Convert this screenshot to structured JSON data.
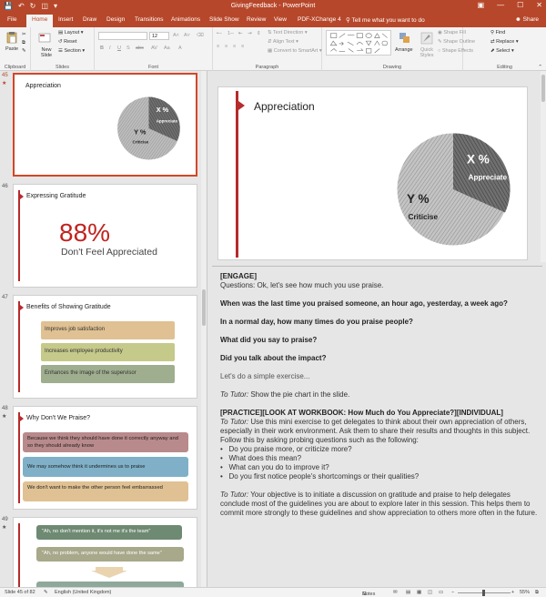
{
  "window": {
    "title": "GivingFeedback - PowerPoint",
    "minimize_glyph": "—",
    "maximize_glyph": "☐",
    "close_glyph": "✕"
  },
  "tabs": [
    "File",
    "Home",
    "Insert",
    "Draw",
    "Design",
    "Transitions",
    "Animations",
    "Slide Show",
    "Review",
    "View",
    "PDF-XChange 4"
  ],
  "tell_me": "Tell me what you want to do",
  "share": "Share",
  "ribbon": {
    "clipboard": {
      "paste": "Paste",
      "label": "Clipboard"
    },
    "slides": {
      "new_slide": "New Slide",
      "layout": "Layout",
      "reset": "Reset",
      "section": "Section",
      "label": "Slides"
    },
    "font": {
      "size": "12",
      "label": "Font"
    },
    "paragraph": {
      "text_direction": "Text Direction",
      "align_text": "Align Text",
      "convert": "Convert to SmartArt",
      "label": "Paragraph"
    },
    "drawing": {
      "arrange": "Arrange",
      "quick_styles": "Quick Styles",
      "shape_fill": "Shape Fill",
      "shape_outline": "Shape Outline",
      "shape_effects": "Shape Effects",
      "label": "Drawing"
    },
    "editing": {
      "find": "Find",
      "replace": "Replace",
      "select": "Select",
      "label": "Editing"
    }
  },
  "thumbnails": {
    "s45": {
      "num": "45",
      "title": "Appreciation",
      "x_label": "X %",
      "x_sub": "Appreciate",
      "y_label": "Y %",
      "y_sub": "Criticise"
    },
    "s46": {
      "num": "46",
      "title": "Expressing Gratitude",
      "big": "88%",
      "sub": "Don't Feel Appreciated"
    },
    "s47": {
      "num": "47",
      "title": "Benefits of Showing Gratitude",
      "items": [
        "Improves job satisfaction",
        "Increases employee productivity",
        "Enhances the image of the supervisor"
      ]
    },
    "s48": {
      "num": "48",
      "title": "Why Don't We Praise?",
      "items": [
        "Because we think they should have done it correctly anyway and so they should already know",
        "We may somehow think it undermines us to praise",
        "We don't want to make the other person feel embarrassed"
      ]
    },
    "s49": {
      "num": "49",
      "items": [
        "\"Ah, no don't mention it, it's not me it's the team\"",
        "\"Ah, no problem, anyone would have done the same\""
      ]
    }
  },
  "slide": {
    "title": "Appreciation",
    "x_label": "X %",
    "x_sub": "Appreciate",
    "y_label": "Y %",
    "y_sub": "Criticise"
  },
  "notes": {
    "engage": "[ENGAGE]",
    "questions": "Questions:  Ok, let's see how much you use praise.",
    "q1": "When was the last time you praised someone, an hour ago, yesterday, a week ago?",
    "q2": "In a normal day, how many times do you praise people?",
    "q3": "What did you say to praise?",
    "q4": "Did you talk about the impact?",
    "exercise": "Let's do a simple exercise...",
    "tutor1_label": "To Tutor:",
    "tutor1_text": " Show the pie chart in the slide.",
    "practice": "[PRACTICE][LOOK AT WORKBOOK: How Much do You Appreciate?][INDIVIDUAL]",
    "tutor2_label": "To Tutor:",
    "tutor2_text": " Use this mini exercise to get delegates to think about their own appreciation of others, especially in their work environment. Ask them to share their results and thoughts in this subject. Follow this by asking probing questions such as the following:",
    "bullets": [
      "Do you praise more, or criticize more?",
      "What does this mean?",
      "What can you do to improve it?",
      "Do you first notice people's shortcomings or their qualities?"
    ],
    "tutor3_label": "To Tutor:",
    "tutor3_text": " Your objective is to initiate a discussion on gratitude and praise to help delegates conclude most of the guidelines you are about to explore later in this session. This helps them to commit more strongly to these guidelines and show appreciation to others more often in the future."
  },
  "status": {
    "slide": "Slide 45 of 82",
    "language": "English (United Kingdom)",
    "notes": "Notes",
    "zoom": "55%"
  },
  "colors": {
    "accent": "#b7472a",
    "slide_red": "#b62b2b",
    "big_stat_red": "#c0231e",
    "tan": "#e0c193",
    "olive": "#c5c98a",
    "sage": "#9fae8e",
    "mauve": "#b98a8c",
    "blue": "#7fb0c8",
    "quote_green": "#6e8a72"
  }
}
